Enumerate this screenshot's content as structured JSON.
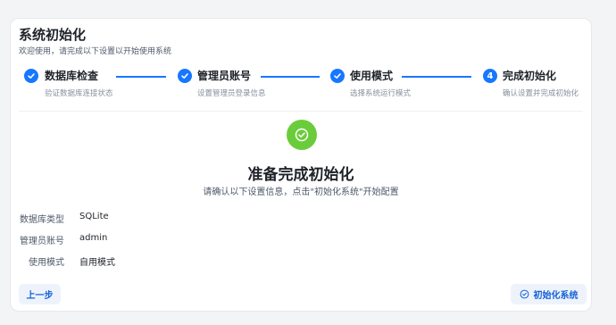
{
  "header": {
    "title": "系统初始化",
    "subtitle": "欢迎使用，请完成以下设置以开始使用系统"
  },
  "steps": [
    {
      "title": "数据库检查",
      "desc": "验证数据库连接状态",
      "status": "done",
      "icon": "check-icon"
    },
    {
      "title": "管理员账号",
      "desc": "设置管理员登录信息",
      "status": "done",
      "icon": "check-icon"
    },
    {
      "title": "使用模式",
      "desc": "选择系统运行模式",
      "status": "done",
      "icon": "check-icon"
    },
    {
      "title": "完成初始化",
      "desc": "确认设置并完成初始化",
      "status": "current",
      "number": "4"
    }
  ],
  "summary": {
    "icon": "check-circle-icon",
    "title": "准备完成初始化",
    "desc": "请确认以下设置信息，点击\"初始化系统\"开始配置",
    "items": [
      {
        "label": "数据库类型",
        "value": "SQLite"
      },
      {
        "label": "管理员账号",
        "value": "admin"
      },
      {
        "label": "使用模式",
        "value": "自用模式"
      }
    ]
  },
  "actions": {
    "prev_label": "上一步",
    "init_label": "初始化系统"
  },
  "colors": {
    "accent": "#1677ff",
    "success": "#52c41a"
  }
}
